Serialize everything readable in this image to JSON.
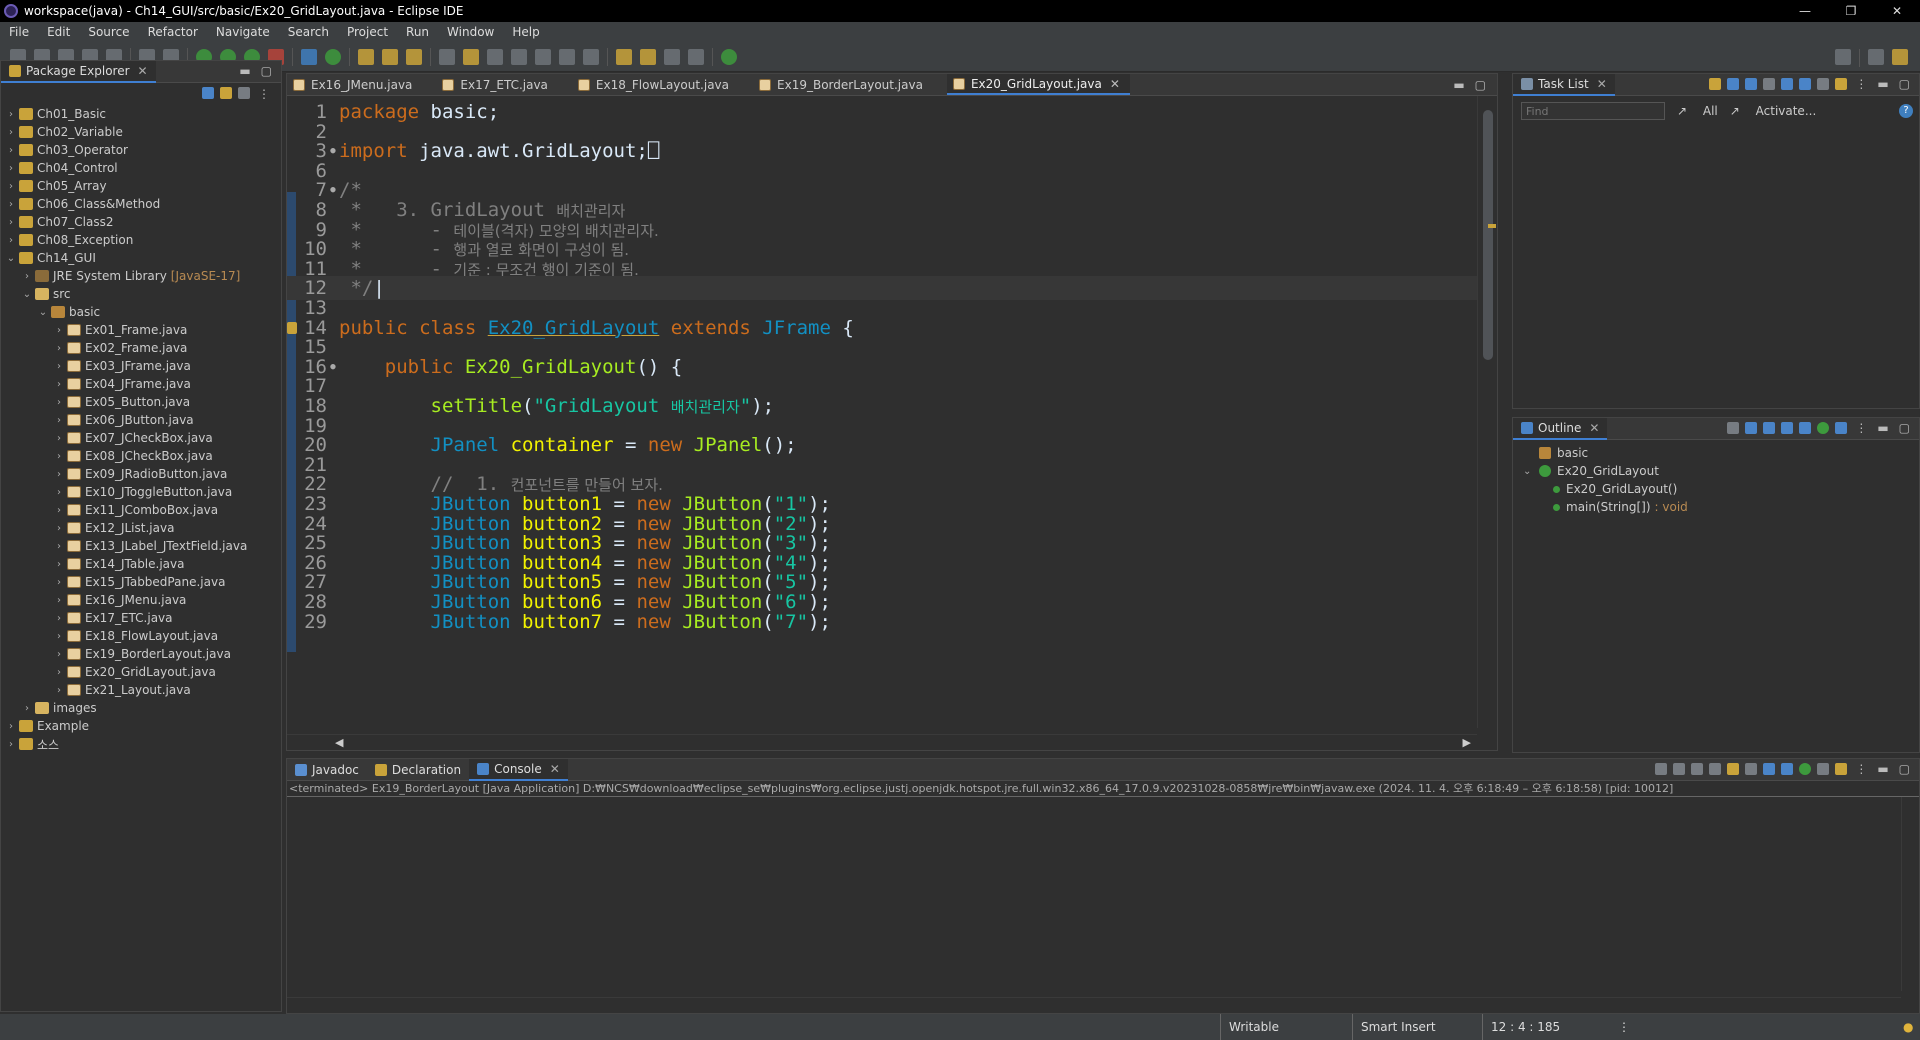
{
  "window": {
    "title": "workspace(java) - Ch14_GUI/src/basic/Ex20_GridLayout.java - Eclipse IDE",
    "minimize": "—",
    "restore": "❐",
    "close": "✕"
  },
  "menu": [
    "File",
    "Edit",
    "Source",
    "Refactor",
    "Navigate",
    "Search",
    "Project",
    "Run",
    "Window",
    "Help"
  ],
  "package_explorer": {
    "title": "Package Explorer",
    "tree": [
      {
        "label": "Ch01_Basic",
        "arrow": "›",
        "icon": "project"
      },
      {
        "label": "Ch02_Variable",
        "arrow": "›",
        "icon": "project"
      },
      {
        "label": "Ch03_Operator",
        "arrow": "›",
        "icon": "project"
      },
      {
        "label": "Ch04_Control",
        "arrow": "›",
        "icon": "project"
      },
      {
        "label": "Ch05_Array",
        "arrow": "›",
        "icon": "project"
      },
      {
        "label": "Ch06_Class&Method",
        "arrow": "›",
        "icon": "project"
      },
      {
        "label": "Ch07_Class2",
        "arrow": "›",
        "icon": "project"
      },
      {
        "label": "Ch08_Exception",
        "arrow": "›",
        "icon": "project"
      },
      {
        "label": "Ch14_GUI",
        "arrow": "⌄",
        "icon": "project"
      },
      {
        "label": "JRE System Library",
        "suffix": "[JavaSE-17]",
        "arrow": "›",
        "icon": "jre",
        "indent": 1
      },
      {
        "label": "src",
        "arrow": "⌄",
        "icon": "folder",
        "indent": 1
      },
      {
        "label": "basic",
        "arrow": "⌄",
        "icon": "pkg",
        "indent": 2
      },
      {
        "label": "Ex01_Frame.java",
        "arrow": "›",
        "icon": "java",
        "indent": 3
      },
      {
        "label": "Ex02_Frame.java",
        "arrow": "›",
        "icon": "java",
        "indent": 3
      },
      {
        "label": "Ex03_JFrame.java",
        "arrow": "›",
        "icon": "java",
        "indent": 3
      },
      {
        "label": "Ex04_JFrame.java",
        "arrow": "›",
        "icon": "java",
        "indent": 3
      },
      {
        "label": "Ex05_Button.java",
        "arrow": "›",
        "icon": "java",
        "indent": 3
      },
      {
        "label": "Ex06_JButton.java",
        "arrow": "›",
        "icon": "java",
        "indent": 3
      },
      {
        "label": "Ex07_JCheckBox.java",
        "arrow": "›",
        "icon": "java",
        "indent": 3
      },
      {
        "label": "Ex08_JCheckBox.java",
        "arrow": "›",
        "icon": "java",
        "indent": 3
      },
      {
        "label": "Ex09_JRadioButton.java",
        "arrow": "›",
        "icon": "java",
        "indent": 3
      },
      {
        "label": "Ex10_JToggleButton.java",
        "arrow": "›",
        "icon": "java",
        "indent": 3
      },
      {
        "label": "Ex11_JComboBox.java",
        "arrow": "›",
        "icon": "java",
        "indent": 3
      },
      {
        "label": "Ex12_JList.java",
        "arrow": "›",
        "icon": "java",
        "indent": 3
      },
      {
        "label": "Ex13_JLabel_JTextField.java",
        "arrow": "›",
        "icon": "java",
        "indent": 3
      },
      {
        "label": "Ex14_JTable.java",
        "arrow": "›",
        "icon": "java",
        "indent": 3
      },
      {
        "label": "Ex15_JTabbedPane.java",
        "arrow": "›",
        "icon": "java",
        "indent": 3
      },
      {
        "label": "Ex16_JMenu.java",
        "arrow": "›",
        "icon": "java",
        "indent": 3
      },
      {
        "label": "Ex17_ETC.java",
        "arrow": "›",
        "icon": "java",
        "indent": 3
      },
      {
        "label": "Ex18_FlowLayout.java",
        "arrow": "›",
        "icon": "java",
        "indent": 3
      },
      {
        "label": "Ex19_BorderLayout.java",
        "arrow": "›",
        "icon": "java",
        "indent": 3
      },
      {
        "label": "Ex20_GridLayout.java",
        "arrow": "›",
        "icon": "java",
        "indent": 3
      },
      {
        "label": "Ex21_Layout.java",
        "arrow": "›",
        "icon": "java",
        "indent": 3
      },
      {
        "label": "images",
        "arrow": "›",
        "icon": "folder",
        "indent": 1
      },
      {
        "label": "Example",
        "arrow": "›",
        "icon": "project"
      },
      {
        "label": "소스",
        "arrow": "›",
        "icon": "project"
      }
    ]
  },
  "editor": {
    "tabs": [
      {
        "label": "Ex16_JMenu.java"
      },
      {
        "label": "Ex17_ETC.java"
      },
      {
        "label": "Ex18_FlowLayout.java"
      },
      {
        "label": "Ex19_BorderLayout.java"
      },
      {
        "label": "Ex20_GridLayout.java",
        "active": true
      }
    ],
    "lines": [
      {
        "n": "1",
        "parts": [
          [
            "kw",
            "package"
          ],
          [
            "plain",
            " basic;"
          ]
        ]
      },
      {
        "n": "2",
        "parts": []
      },
      {
        "n": "3",
        "fold": "●",
        "parts": [
          [
            "kw",
            "import"
          ],
          [
            "plain",
            " java.awt.GridLayout;"
          ],
          [
            "plain",
            "⎕"
          ]
        ]
      },
      {
        "n": "6",
        "parts": []
      },
      {
        "n": "7",
        "fold": "●",
        "parts": [
          [
            "cm",
            "/*"
          ]
        ]
      },
      {
        "n": "8",
        "parts": [
          [
            "cm",
            " *   3. GridLayout "
          ],
          [
            "cmk",
            "배치관리자"
          ]
        ]
      },
      {
        "n": "9",
        "parts": [
          [
            "cm",
            " *      - "
          ],
          [
            "cmk",
            "테이블(격자) 모양의 배치관리자."
          ]
        ]
      },
      {
        "n": "10",
        "parts": [
          [
            "cm",
            " *      - "
          ],
          [
            "cmk",
            "행과 열로 화면이 구성이 됨."
          ]
        ]
      },
      {
        "n": "11",
        "parts": [
          [
            "cm",
            " *      - "
          ],
          [
            "cmk",
            "기준 : 무조건 행이 기준이 됨."
          ]
        ]
      },
      {
        "n": "12",
        "current": true,
        "parts": [
          [
            "cm",
            " */"
          ],
          [
            "plain",
            "|"
          ]
        ]
      },
      {
        "n": "13",
        "parts": []
      },
      {
        "n": "14",
        "warn": true,
        "parts": [
          [
            "kw",
            "public class "
          ],
          [
            "cls",
            "Ex20_GridLayout"
          ],
          [
            "kw",
            " extends "
          ],
          [
            "typ",
            "JFrame"
          ],
          [
            "plain",
            " {"
          ]
        ]
      },
      {
        "n": "15",
        "parts": []
      },
      {
        "n": "16",
        "fold": "●",
        "parts": [
          [
            "plain",
            "    "
          ],
          [
            "kw",
            "public "
          ],
          [
            "fn",
            "Ex20_GridLayout"
          ],
          [
            "plain",
            "() {"
          ]
        ]
      },
      {
        "n": "17",
        "parts": []
      },
      {
        "n": "18",
        "parts": [
          [
            "plain",
            "        "
          ],
          [
            "fn",
            "setTitle"
          ],
          [
            "plain",
            "("
          ],
          [
            "str",
            "\"GridLayout "
          ],
          [
            "strk",
            "배치관리자"
          ],
          [
            "str",
            "\""
          ],
          [
            "plain",
            ");"
          ]
        ]
      },
      {
        "n": "19",
        "parts": []
      },
      {
        "n": "20",
        "parts": [
          [
            "plain",
            "        "
          ],
          [
            "typ",
            "JPanel"
          ],
          [
            "id",
            " container"
          ],
          [
            "plain",
            " = "
          ],
          [
            "kw",
            "new "
          ],
          [
            "fn",
            "JPanel"
          ],
          [
            "plain",
            "();"
          ]
        ]
      },
      {
        "n": "21",
        "parts": []
      },
      {
        "n": "22",
        "parts": [
          [
            "cm",
            "        //  1. "
          ],
          [
            "cmk",
            "컨포넌트를 만들어 보자."
          ]
        ]
      },
      {
        "n": "23",
        "parts": [
          [
            "plain",
            "        "
          ],
          [
            "typ",
            "JButton"
          ],
          [
            "id",
            " button1"
          ],
          [
            "plain",
            " = "
          ],
          [
            "kw",
            "new "
          ],
          [
            "fn",
            "JButton"
          ],
          [
            "plain",
            "("
          ],
          [
            "str",
            "\"1\""
          ],
          [
            "plain",
            ");"
          ]
        ]
      },
      {
        "n": "24",
        "parts": [
          [
            "plain",
            "        "
          ],
          [
            "typ",
            "JButton"
          ],
          [
            "id",
            " button2"
          ],
          [
            "plain",
            " = "
          ],
          [
            "kw",
            "new "
          ],
          [
            "fn",
            "JButton"
          ],
          [
            "plain",
            "("
          ],
          [
            "str",
            "\"2\""
          ],
          [
            "plain",
            ");"
          ]
        ]
      },
      {
        "n": "25",
        "parts": [
          [
            "plain",
            "        "
          ],
          [
            "typ",
            "JButton"
          ],
          [
            "id",
            " button3"
          ],
          [
            "plain",
            " = "
          ],
          [
            "kw",
            "new "
          ],
          [
            "fn",
            "JButton"
          ],
          [
            "plain",
            "("
          ],
          [
            "str",
            "\"3\""
          ],
          [
            "plain",
            ");"
          ]
        ]
      },
      {
        "n": "26",
        "parts": [
          [
            "plain",
            "        "
          ],
          [
            "typ",
            "JButton"
          ],
          [
            "id",
            " button4"
          ],
          [
            "plain",
            " = "
          ],
          [
            "kw",
            "new "
          ],
          [
            "fn",
            "JButton"
          ],
          [
            "plain",
            "("
          ],
          [
            "str",
            "\"4\""
          ],
          [
            "plain",
            ");"
          ]
        ]
      },
      {
        "n": "27",
        "parts": [
          [
            "plain",
            "        "
          ],
          [
            "typ",
            "JButton"
          ],
          [
            "id",
            " button5"
          ],
          [
            "plain",
            " = "
          ],
          [
            "kw",
            "new "
          ],
          [
            "fn",
            "JButton"
          ],
          [
            "plain",
            "("
          ],
          [
            "str",
            "\"5\""
          ],
          [
            "plain",
            ");"
          ]
        ]
      },
      {
        "n": "28",
        "parts": [
          [
            "plain",
            "        "
          ],
          [
            "typ",
            "JButton"
          ],
          [
            "id",
            " button6"
          ],
          [
            "plain",
            " = "
          ],
          [
            "kw",
            "new "
          ],
          [
            "fn",
            "JButton"
          ],
          [
            "plain",
            "("
          ],
          [
            "str",
            "\"6\""
          ],
          [
            "plain",
            ");"
          ]
        ]
      },
      {
        "n": "29",
        "parts": [
          [
            "plain",
            "        "
          ],
          [
            "typ",
            "JButton"
          ],
          [
            "id",
            " button7"
          ],
          [
            "plain",
            " = "
          ],
          [
            "kw",
            "new "
          ],
          [
            "fn",
            "JButton"
          ],
          [
            "plain",
            "("
          ],
          [
            "str",
            "\"7\""
          ],
          [
            "plain",
            ");"
          ]
        ]
      }
    ]
  },
  "tasklist": {
    "title": "Task List",
    "find_placeholder": "Find",
    "all": "All",
    "activate": "Activate...",
    "help": "?"
  },
  "outline": {
    "title": "Outline",
    "items": [
      {
        "label": "basic",
        "icon": "pkg"
      },
      {
        "label": "Ex20_GridLayout",
        "arrow": "⌄",
        "icon": "class"
      },
      {
        "label": "Ex20_GridLayout()",
        "icon": "ctor",
        "indent": 1
      },
      {
        "label": "main(String[])",
        "ret": ": void",
        "icon": "method",
        "indent": 1
      }
    ]
  },
  "console": {
    "tabs": [
      {
        "label": "Javadoc"
      },
      {
        "label": "Declaration"
      },
      {
        "label": "Console",
        "active": true
      }
    ],
    "status": "<terminated> Ex19_BorderLayout [Java Application] D:₩NCS₩download₩eclipse_se₩plugins₩org.eclipse.justj.openjdk.hotspot.jre.full.win32.x86_64_17.0.9.v20231028-0858₩jre₩bin₩javaw.exe  (2024. 11. 4. 오후 6:18:49 – 오후 6:18:58) [pid: 10012]"
  },
  "statusbar": {
    "writable": "Writable",
    "insert_mode": "Smart Insert",
    "position": "12 : 4 : 185"
  },
  "colors": {
    "keyword": "#cc6c1d",
    "type": "#1290c3",
    "string": "#17c6a3",
    "comment": "#808080",
    "identifier": "#f2f200",
    "method": "#a7ec21",
    "accent": "#3f7fd2"
  }
}
